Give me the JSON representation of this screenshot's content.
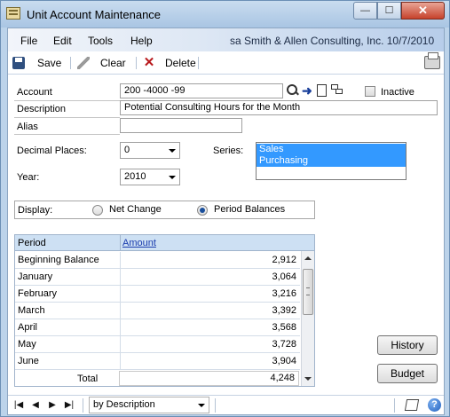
{
  "window": {
    "title": "Unit Account Maintenance",
    "controls": {
      "minimize": "—",
      "maximize": "☐",
      "close": "✕"
    }
  },
  "menu": {
    "items": [
      "File",
      "Edit",
      "Tools",
      "Help"
    ],
    "user_info": "sa  Smith & Allen Consulting, Inc.  10/7/2010"
  },
  "toolbar": {
    "save_label": "Save",
    "clear_label": "Clear",
    "delete_label": "Delete",
    "print_icon": "printer-icon"
  },
  "form": {
    "account_label": "Account",
    "account_value": "200 -4000 -99",
    "inactive_label": "Inactive",
    "inactive_checked": false,
    "description_label": "Description",
    "description_value": "Potential Consulting Hours for the Month",
    "alias_label": "Alias",
    "alias_value": "",
    "decimal_label": "Decimal Places:",
    "decimal_value": "0",
    "series_label": "Series:",
    "series_options": [
      "Sales",
      "Purchasing"
    ],
    "year_label": "Year:",
    "year_value": "2010"
  },
  "display": {
    "label": "Display:",
    "net_change_label": "Net Change",
    "period_balances_label": "Period Balances",
    "selected": "Period Balances"
  },
  "grid": {
    "headers": {
      "period": "Period",
      "amount": "Amount"
    },
    "rows": [
      {
        "period": "Beginning Balance",
        "amount": "2,912"
      },
      {
        "period": "January",
        "amount": "3,064"
      },
      {
        "period": "February",
        "amount": "3,216"
      },
      {
        "period": "March",
        "amount": "3,392"
      },
      {
        "period": "April",
        "amount": "3,568"
      },
      {
        "period": "May",
        "amount": "3,728"
      },
      {
        "period": "June",
        "amount": "3,904"
      }
    ],
    "total_label": "Total",
    "total_value": "4,248"
  },
  "buttons": {
    "history_label": "History",
    "budget_label": "Budget"
  },
  "status": {
    "nav": [
      "|◀",
      "◀",
      "▶",
      "▶|"
    ],
    "sort_value": "by Description"
  }
}
